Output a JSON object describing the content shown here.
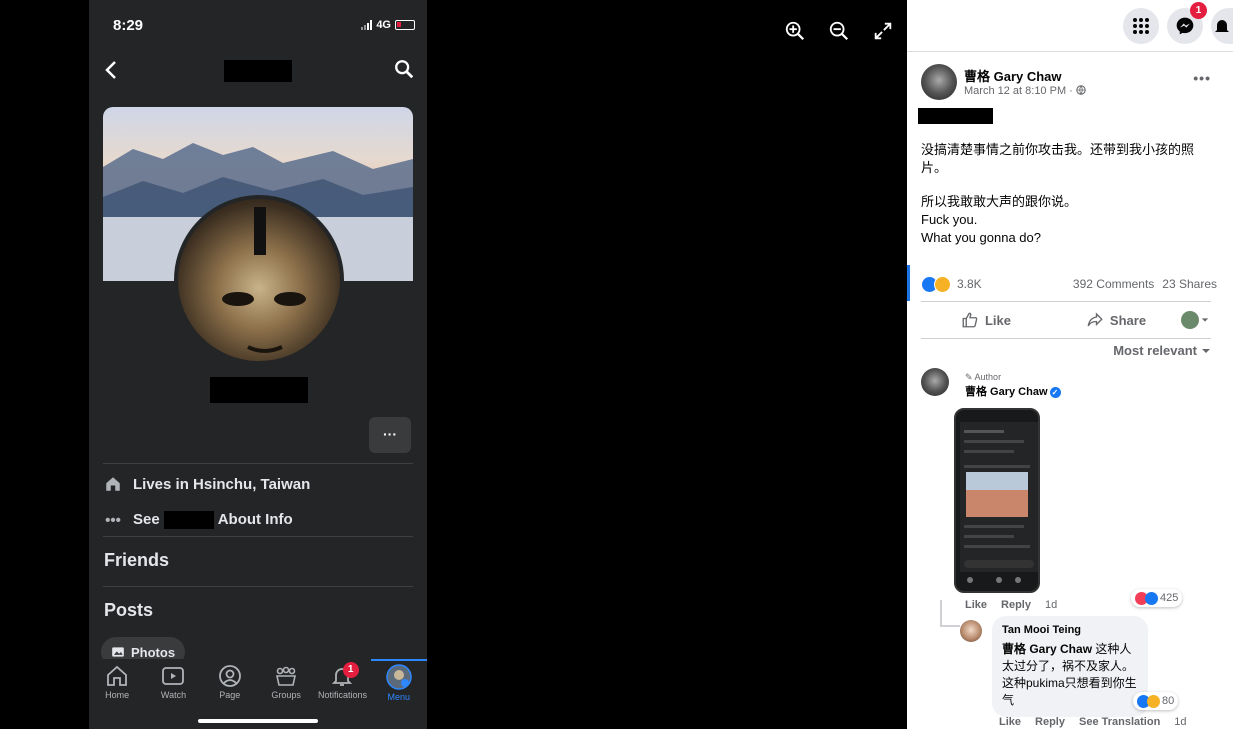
{
  "phone": {
    "status": {
      "time": "8:29",
      "network": "4G"
    },
    "profile": {
      "lives_in": "Lives in Hsinchu, Taiwan",
      "see_prefix": "See",
      "see_suffix": "About Info",
      "more_label": "···",
      "friends_title": "Friends",
      "posts_title": "Posts",
      "photos_chip": "Photos"
    },
    "tabs": [
      {
        "label": "Home",
        "icon": "home-icon"
      },
      {
        "label": "Watch",
        "icon": "watch-icon"
      },
      {
        "label": "Page",
        "icon": "page-icon"
      },
      {
        "label": "Groups",
        "icon": "groups-icon"
      },
      {
        "label": "Notifications",
        "icon": "bell-icon",
        "badge": "1"
      },
      {
        "label": "Menu",
        "icon": "menu-avatar-icon",
        "active": true
      }
    ]
  },
  "viewer": {
    "tools": [
      "zoom-in-icon",
      "zoom-out-icon",
      "fullscreen-icon"
    ]
  },
  "panel": {
    "topbar": {
      "messenger_badge": "1"
    },
    "post": {
      "author": "曹格 Gary Chaw",
      "date": "March 12 at 8:10 PM ·",
      "more": "•••",
      "body_line1": "没搞清楚事情之前你攻击我。还带到我小孩的照片。",
      "body_line2": "所以我敢敢大声的跟你说。",
      "body_line3": "Fuck you.",
      "body_line4": "What you gonna do?",
      "reactions_count": "3.8K",
      "comments_count": "392 Comments",
      "shares_count": "23 Shares",
      "like_label": "Like",
      "share_label": "Share",
      "sort_label": "Most relevant"
    },
    "comments": [
      {
        "author_tag": "Author",
        "name": "曹格 Gary Chaw",
        "reaction_count": "425",
        "like": "Like",
        "reply": "Reply",
        "time": "1d"
      },
      {
        "name": "Tan Mooi Teing",
        "mention": "曹格 Gary Chaw",
        "text": " 这种人太过分了，祸不及家人。这种pukima只想看到你生气",
        "reaction_count": "80",
        "like": "Like",
        "reply": "Reply",
        "see_translation": "See Translation",
        "time": "1d"
      }
    ]
  },
  "colors": {
    "fb_blue": "#1877f2",
    "badge_red": "#e41e3f",
    "dark_bg": "#242526",
    "active_tab": "#2d88ff"
  }
}
